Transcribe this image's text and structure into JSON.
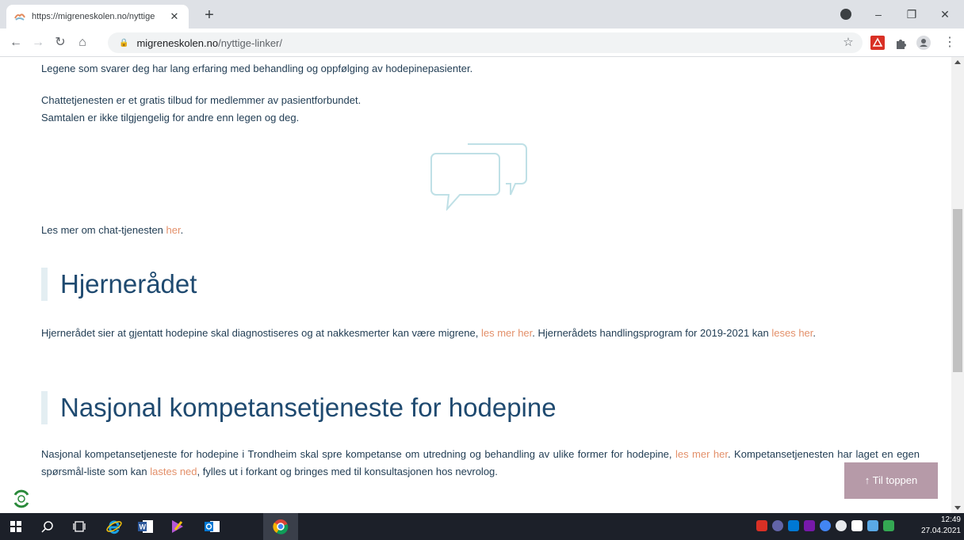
{
  "browser": {
    "tab_title": "https://migreneskolen.no/nyttige",
    "tab_close": "✕",
    "new_tab": "+",
    "window_controls": [
      "–",
      "❐",
      "✕"
    ],
    "url_domain": "migreneskolen.no",
    "url_path": "/nyttige-linker/"
  },
  "content": {
    "p1": "Legene som svarer deg har lang erfaring med behandling og oppfølging av hodepinepasienter.",
    "p2": "Chattetjenesten er et gratis tilbud for medlemmer av pasientforbundet.",
    "p3": "Samtalen er ikke tilgjengelig for andre enn legen og deg.",
    "p4_text": "Les mer om chat-tjenesten ",
    "p4_link": "her",
    "p4_end": ".",
    "h_hjernerad": "Hjernerådet",
    "hj_text1": "Hjernerådet sier at gjentatt hodepine skal diagnostiseres og at nakkesmerter kan være migrene, ",
    "hj_link1": "les mer her",
    "hj_text2": ". Hjernerådets handlingsprogram for 2019-2021 kan ",
    "hj_link2": "leses her",
    "hj_text3": ".",
    "h_nasjonal": "Nasjonal kompetansetjeneste for hodepine",
    "na_text1": "Nasjonal kompetansetjeneste for hodepine i Trondheim skal spre kompetanse om utredning og behandling av ulike former for hodepine, ",
    "na_link1": "les mer her",
    "na_text2": ". Kompetansetjenesten har laget en egen spørsmål-liste som kan ",
    "na_link2": "lastes ned",
    "na_text3": ", fylles ut i forkant og bringes med til konsultasjonen hos nevrolog.",
    "to_top": "↑  Til toppen"
  },
  "taskbar": {
    "time": "12:49",
    "date": "27.04.2021"
  },
  "colors": {
    "link": "#e3906a",
    "heading": "#1f4a70",
    "text": "#1f3b52",
    "to_top_bg": "#b69aa8"
  }
}
